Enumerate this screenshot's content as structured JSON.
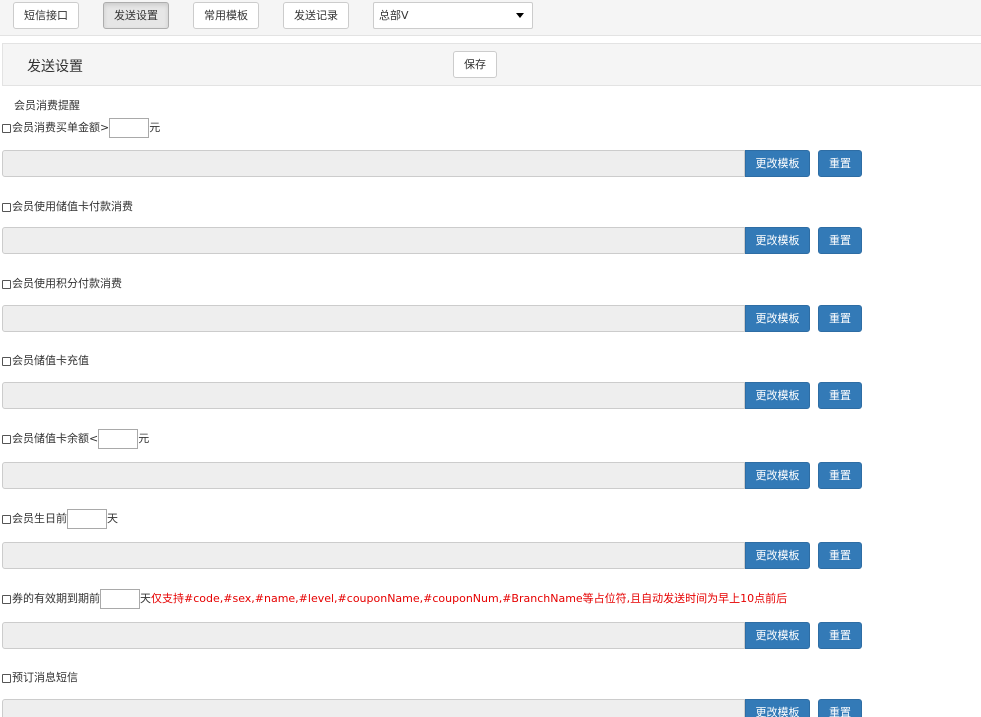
{
  "tabs": [
    {
      "label": "短信接口",
      "active": false
    },
    {
      "label": "发送设置",
      "active": true
    },
    {
      "label": "常用模板",
      "active": false
    },
    {
      "label": "发送记录",
      "active": false
    }
  ],
  "branch_select": {
    "value": "总部V"
  },
  "panel": {
    "title": "发送设置",
    "save_label": "保存"
  },
  "section_title": "会员消费提醒",
  "settings": [
    {
      "text_before": "会员消费买单金额>",
      "has_input": true,
      "suffix": "元",
      "hint": ""
    },
    {
      "text_before": "会员使用储值卡付款消费",
      "has_input": false,
      "suffix": "",
      "hint": ""
    },
    {
      "text_before": "会员使用积分付款消费",
      "has_input": false,
      "suffix": "",
      "hint": ""
    },
    {
      "text_before": "会员储值卡充值",
      "has_input": false,
      "suffix": "",
      "hint": ""
    },
    {
      "text_before": "会员储值卡余额<",
      "has_input": true,
      "suffix": "元",
      "hint": ""
    },
    {
      "text_before": "会员生日前",
      "has_input": true,
      "suffix": "天",
      "hint": ""
    },
    {
      "text_before": "券的有效期到期前",
      "has_input": true,
      "suffix": "天",
      "hint": "仅支持#code,#sex,#name,#level,#couponName,#couponNum,#BranchName等占位符,且自动发送时间为早上10点前后"
    },
    {
      "text_before": "预订消息短信",
      "has_input": false,
      "suffix": "",
      "hint": ""
    }
  ],
  "buttons": {
    "change_template": "更改模板",
    "reset": "重置"
  },
  "colors": {
    "primary": "#337ab7",
    "hint": "#e60000",
    "disabled_field": "#eeeeee"
  }
}
